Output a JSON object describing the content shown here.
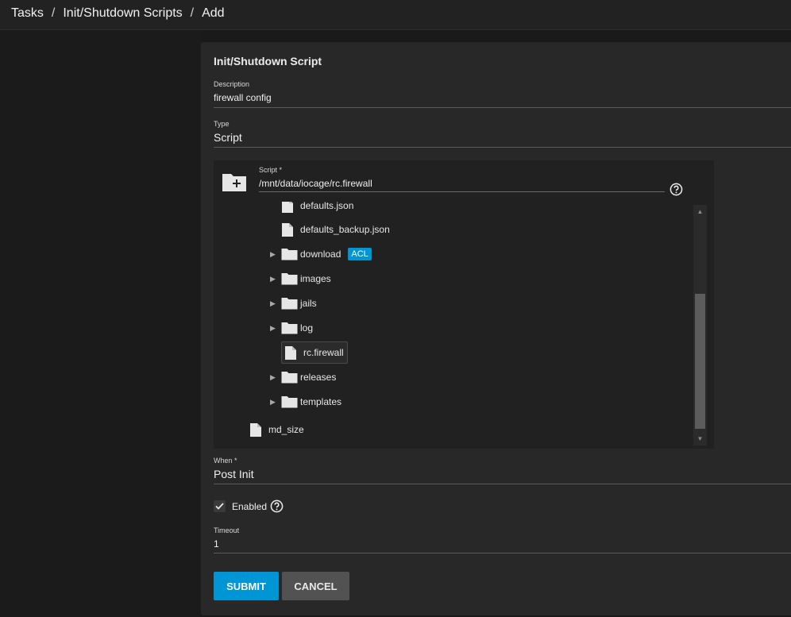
{
  "breadcrumb": {
    "items": [
      "Tasks",
      "Init/Shutdown Scripts",
      "Add"
    ],
    "separator": "/"
  },
  "form": {
    "title": "Init/Shutdown Script",
    "description": {
      "label": "Description",
      "value": "firewall config"
    },
    "type": {
      "label": "Type",
      "value": "Script"
    },
    "script": {
      "label": "Script *",
      "value": "/mnt/data/iocage/rc.firewall",
      "tree": [
        {
          "name": "defaults.json",
          "kind": "file",
          "expandable": false
        },
        {
          "name": "defaults_backup.json",
          "kind": "file",
          "expandable": false
        },
        {
          "name": "download",
          "kind": "folder",
          "expandable": true,
          "badge": "ACL"
        },
        {
          "name": "images",
          "kind": "folder",
          "expandable": true
        },
        {
          "name": "jails",
          "kind": "folder",
          "expandable": true
        },
        {
          "name": "log",
          "kind": "folder",
          "expandable": true
        },
        {
          "name": "rc.firewall",
          "kind": "file",
          "expandable": false,
          "selected": true
        },
        {
          "name": "releases",
          "kind": "folder",
          "expandable": true
        },
        {
          "name": "templates",
          "kind": "folder",
          "expandable": true
        },
        {
          "name": "md_size",
          "kind": "file",
          "expandable": false
        }
      ]
    },
    "when": {
      "label": "When *",
      "value": "Post Init"
    },
    "enabled": {
      "label": "Enabled",
      "checked": true
    },
    "timeout": {
      "label": "Timeout",
      "value": "1"
    },
    "buttons": {
      "submit": "SUBMIT",
      "cancel": "CANCEL"
    }
  },
  "colors": {
    "accent": "#0095d5",
    "background": "#1a1a1a",
    "card": "#282828"
  },
  "icons": [
    "folder-add-icon",
    "help-icon",
    "folder-icon",
    "file-icon",
    "expand-arrow-icon",
    "check-icon"
  ]
}
